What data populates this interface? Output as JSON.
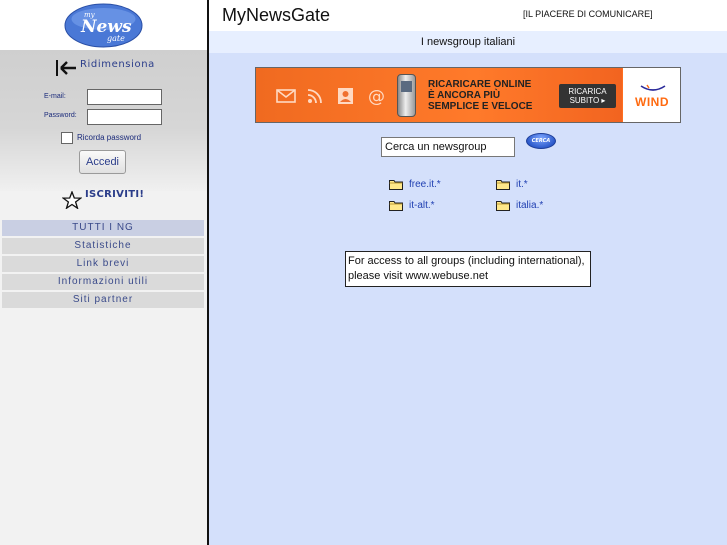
{
  "logo": {
    "text_top": "my",
    "text_main": "News",
    "text_bottom": "gate"
  },
  "sidebar": {
    "resize_label": "Ridimensiona",
    "email_label": "E-mail:",
    "email_value": "",
    "password_label": "Password:",
    "password_value": "",
    "remember_label": "Ricorda password",
    "remember_checked": false,
    "login_label": "Accedi",
    "signup_label": "ISCRIVITI!",
    "nav": [
      {
        "label": "TUTTI I NG",
        "active": true
      },
      {
        "label": "Statistiche"
      },
      {
        "label": "Link brevi"
      },
      {
        "label": "Informazioni utili"
      },
      {
        "label": "Siti partner"
      }
    ]
  },
  "header": {
    "title": "MyNewsGate",
    "tagline": "[IL PIACERE DI COMUNICARE]",
    "subtitle": "I newsgroup italiani"
  },
  "banner": {
    "line1": "RICARICARE ONLINE",
    "line2": "È ANCORA PIÙ",
    "line3": "SEMPLICE E VELOCE",
    "cta_line1": "RICARICA",
    "cta_line2": "SUBITO ▸",
    "brand": "WIND",
    "accent": "#ff6e1f"
  },
  "search": {
    "value": "Cerca un newsgroup",
    "button_label": "CERCA"
  },
  "groups": [
    {
      "label": "free.it.*"
    },
    {
      "label": "it.*"
    },
    {
      "label": "it-alt.*"
    },
    {
      "label": "italia.*"
    }
  ],
  "notice": "For access to all groups (including international),\nplease visit www.webuse.net",
  "colors": {
    "sidebar_bg": "#f2f2f2",
    "main_bg": "#d4e0fb",
    "link": "#1f3fb2",
    "nav_text": "#3a4a8a"
  }
}
